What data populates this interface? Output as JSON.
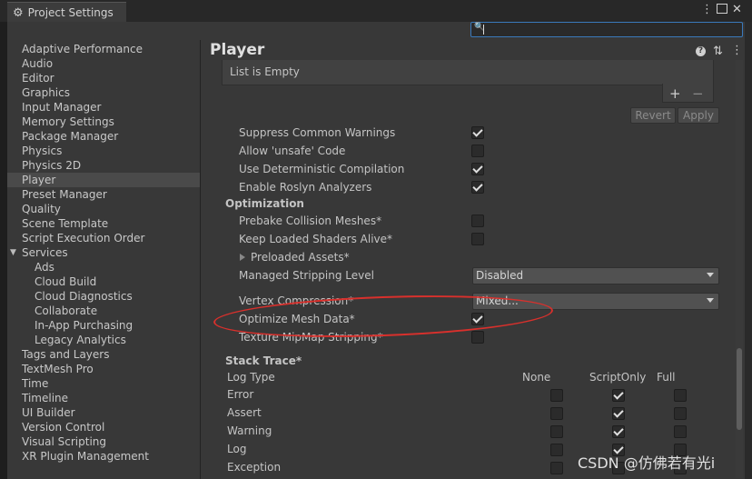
{
  "window": {
    "title": "Project Settings",
    "menu_icon": "kebab-menu-icon",
    "maximize_icon": "maximize-icon",
    "close_icon": "close-icon",
    "close_glyph": "✕"
  },
  "search": {
    "placeholder": "",
    "value": ""
  },
  "sidebar": {
    "items": [
      {
        "label": "Adaptive Performance"
      },
      {
        "label": "Audio"
      },
      {
        "label": "Editor"
      },
      {
        "label": "Graphics"
      },
      {
        "label": "Input Manager"
      },
      {
        "label": "Memory Settings"
      },
      {
        "label": "Package Manager"
      },
      {
        "label": "Physics"
      },
      {
        "label": "Physics 2D"
      },
      {
        "label": "Player",
        "selected": true
      },
      {
        "label": "Preset Manager"
      },
      {
        "label": "Quality"
      },
      {
        "label": "Scene Template"
      },
      {
        "label": "Script Execution Order"
      },
      {
        "label": "Services",
        "expanded": true
      },
      {
        "label": "Ads",
        "child": true
      },
      {
        "label": "Cloud Build",
        "child": true
      },
      {
        "label": "Cloud Diagnostics",
        "child": true
      },
      {
        "label": "Collaborate",
        "child": true
      },
      {
        "label": "In-App Purchasing",
        "child": true
      },
      {
        "label": "Legacy Analytics",
        "child": true
      },
      {
        "label": "Tags and Layers"
      },
      {
        "label": "TextMesh Pro"
      },
      {
        "label": "Time"
      },
      {
        "label": "Timeline"
      },
      {
        "label": "UI Builder"
      },
      {
        "label": "Version Control"
      },
      {
        "label": "Visual Scripting"
      },
      {
        "label": "XR Plugin Management"
      }
    ]
  },
  "panel": {
    "title": "Player",
    "help_icon": "help-icon",
    "presets_icon": "presets-icon",
    "menu_icon": "kebab-menu-icon",
    "list_empty": "List is Empty",
    "plus": "+",
    "minus": "−",
    "revert": "Revert",
    "apply": "Apply",
    "settings": [
      {
        "label": "Suppress Common Warnings",
        "checked": true
      },
      {
        "label": "Allow 'unsafe' Code",
        "checked": false
      },
      {
        "label": "Use Deterministic Compilation",
        "checked": true
      },
      {
        "label": "Enable Roslyn Analyzers",
        "checked": true
      }
    ],
    "optimization_header": "Optimization",
    "optimization": [
      {
        "label": "Prebake Collision Meshes*",
        "checked": false
      },
      {
        "label": "Keep Loaded Shaders Alive*",
        "checked": false
      }
    ],
    "preloaded_assets": "Preloaded Assets*",
    "managed_stripping_label": "Managed Stripping Level",
    "managed_stripping_value": "Disabled",
    "vertex_compression_label": "Vertex Compression*",
    "vertex_compression_value": "Mixed...",
    "optimize_mesh": {
      "label": "Optimize Mesh Data*",
      "checked": true
    },
    "texture_mipmap": {
      "label": "Texture MipMap Stripping*",
      "checked": false
    },
    "stack_trace": {
      "header": "Stack Trace*",
      "columns": [
        "Log Type",
        "None",
        "ScriptOnly",
        "Full"
      ],
      "rows": [
        {
          "label": "Error",
          "values": [
            false,
            true,
            false
          ]
        },
        {
          "label": "Assert",
          "values": [
            false,
            true,
            false
          ]
        },
        {
          "label": "Warning",
          "values": [
            false,
            true,
            false
          ]
        },
        {
          "label": "Log",
          "values": [
            false,
            true,
            false
          ]
        },
        {
          "label": "Exception",
          "values": [
            false,
            false,
            false
          ]
        }
      ]
    }
  },
  "watermark": "CSDN @仿佛若有光i",
  "colors": {
    "highlight_oval": "#d9302c",
    "search_focus": "#3a79bb"
  }
}
